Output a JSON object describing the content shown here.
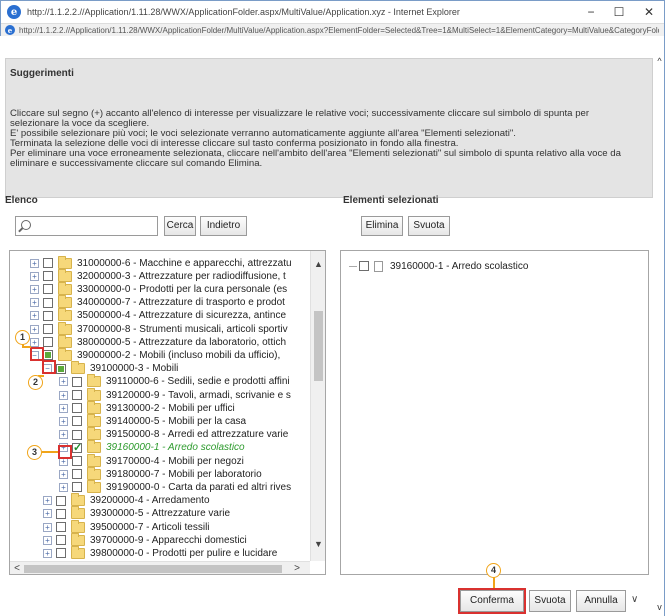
{
  "window": {
    "title": "http://1.1.2.2.//Application/1.11.28/WWX/ApplicationFolder.aspx/MultiValue/Application.xyz - Internet Explorer",
    "address": "http://1.1.2.2.//Application/1.11.28/WWX/ApplicationFolder/MultiValue/Application.aspx?ElementFolder=Selected&Tree=1&MultiSelect=1&ElementCategory=MultiValue&CategoryFolder=Selezione",
    "minimize": "−",
    "maximize": "☐",
    "close": "✕"
  },
  "hints": {
    "title": "Suggerimenti",
    "lines": [
      "Cliccare sul segno (+) accanto all'elenco di interesse per visualizzare le relative voci; successivamente cliccare sul simbolo di spunta per",
      "selezionare la voce da scegliere.",
      "E' possibile selezionare più voci; le voci selezionate verranno automaticamente aggiunte all'area \"Elementi selezionati\".",
      "Terminata la selezione delle voci di interesse cliccare sul tasto conferma posizionato in fondo alla finestra.",
      "Per eliminare una voce erroneamente selezionata, cliccare nell'ambito dell'area \"Elementi selezionati\" sul simbolo di spunta relativo alla voce da",
      "eliminare e successivamente cliccare sul comando Elimina."
    ]
  },
  "elenco": {
    "label": "Elenco",
    "search_value": "",
    "search_button": "Cerca",
    "back_button": "Indietro",
    "rows": [
      {
        "label": "31000000-6 - Macchine e apparecchi, attrezzatu",
        "expander": "+",
        "check": "",
        "icon": "folder",
        "level": 0
      },
      {
        "label": "32000000-3 - Attrezzature per radiodiffusione, t",
        "expander": "+",
        "check": "",
        "icon": "folder",
        "level": 0
      },
      {
        "label": "33000000-0 - Prodotti per la cura personale (es",
        "expander": "+",
        "check": "",
        "icon": "folder",
        "level": 0
      },
      {
        "label": "34000000-7 - Attrezzature di trasporto e prodot",
        "expander": "+",
        "check": "",
        "icon": "folder",
        "level": 0
      },
      {
        "label": "35000000-4 - Attrezzature di sicurezza, antince",
        "expander": "+",
        "check": "",
        "icon": "folder",
        "level": 0
      },
      {
        "label": "37000000-8 - Strumenti musicali, articoli sportiv",
        "expander": "+",
        "check": "",
        "icon": "folder",
        "level": 0
      },
      {
        "label": "38000000-5 - Attrezzature da laboratorio, ottich",
        "expander": "+",
        "check": "",
        "icon": "folder",
        "level": 0
      },
      {
        "label": "39000000-2 - Mobili (incluso mobili da ufficio), ",
        "expander": "−",
        "check": "partial",
        "icon": "folder",
        "level": 0
      },
      {
        "label": "39100000-3 - Mobili",
        "expander": "−",
        "check": "partial",
        "icon": "folder",
        "level": 1
      },
      {
        "label": "39110000-6 - Sedili, sedie e prodotti affini",
        "expander": "+",
        "check": "",
        "icon": "folder",
        "level": 2
      },
      {
        "label": "39120000-9 - Tavoli, armadi, scrivanie e s",
        "expander": "+",
        "check": "",
        "icon": "folder",
        "level": 2
      },
      {
        "label": "39130000-2 - Mobili per uffici",
        "expander": "+",
        "check": "",
        "icon": "folder",
        "level": 2
      },
      {
        "label": "39140000-5 - Mobili per la casa",
        "expander": "+",
        "check": "",
        "icon": "folder",
        "level": 2
      },
      {
        "label": "39150000-8 - Arredi ed attrezzature varie",
        "expander": "+",
        "check": "",
        "icon": "folder",
        "level": 2
      },
      {
        "label": "39160000-1 - Arredo scolastico",
        "expander": "+",
        "check": "checked",
        "icon": "folder",
        "level": 2,
        "selected": true
      },
      {
        "label": "39170000-4 - Mobili per negozi",
        "expander": "+",
        "check": "",
        "icon": "folder",
        "level": 2
      },
      {
        "label": "39180000-7 - Mobili per laboratorio",
        "expander": "+",
        "check": "",
        "icon": "folder",
        "level": 2
      },
      {
        "label": "39190000-0 - Carta da parati ed altri rives",
        "expander": "+",
        "check": "",
        "icon": "folder",
        "level": 2
      },
      {
        "label": "39200000-4 - Arredamento",
        "expander": "+",
        "check": "",
        "icon": "folder",
        "level": 1
      },
      {
        "label": "39300000-5 - Attrezzature varie",
        "expander": "+",
        "check": "",
        "icon": "folder",
        "level": 1
      },
      {
        "label": "39500000-7 - Articoli tessili",
        "expander": "+",
        "check": "",
        "icon": "folder",
        "level": 1
      },
      {
        "label": "39700000-9 - Apparecchi domestici",
        "expander": "+",
        "check": "",
        "icon": "folder",
        "level": 1
      },
      {
        "label": "39800000-0 - Prodotti per pulire e lucidare",
        "expander": "+",
        "check": "",
        "icon": "folder",
        "level": 1
      }
    ]
  },
  "selezionati": {
    "label": "Elementi selezionati",
    "delete_button": "Elimina",
    "clear_button": "Svuota",
    "items": [
      {
        "label": "39160000-1 - Arredo scolastico"
      }
    ]
  },
  "footer": {
    "confirm_button": "Conferma",
    "clear_button": "Svuota",
    "cancel_button": "Annulla"
  },
  "callouts": [
    "1",
    "2",
    "3",
    "4"
  ],
  "colors": {
    "callout_border": "#f0a419",
    "highlight_box": "#d9312f",
    "selected_text": "#2c9a2c",
    "hints_background": "#e4e4e4"
  }
}
